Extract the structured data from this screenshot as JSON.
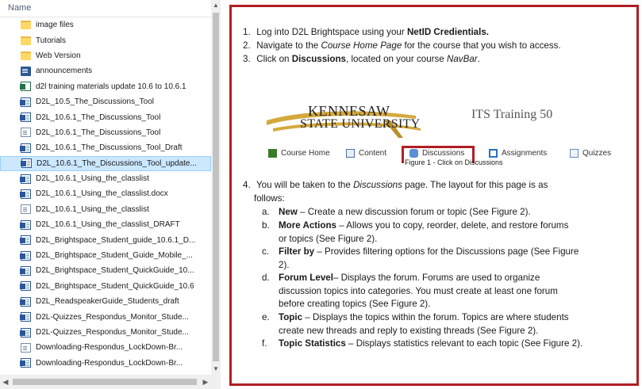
{
  "file_pane": {
    "column_header": "Name",
    "files": [
      {
        "name": "image files",
        "icon": "folder-icon",
        "type": "folder"
      },
      {
        "name": "Tutorials",
        "icon": "folder-icon",
        "type": "folder"
      },
      {
        "name": "Web Version",
        "icon": "folder-icon",
        "type": "folder"
      },
      {
        "name": "announcements",
        "icon": "docx-icon",
        "type": "docx"
      },
      {
        "name": "d2l training materials update 10.6 to 10.6.1",
        "icon": "excel-icon",
        "type": "xls"
      },
      {
        "name": "D2L_10.5_The_Discussions_Tool",
        "icon": "word-doc-icon",
        "type": "wdoc"
      },
      {
        "name": "D2L_10.6.1_The_Discussions_Tool",
        "icon": "word-doc-icon",
        "type": "wdoc"
      },
      {
        "name": "D2L_10.6.1_The_Discussions_Tool",
        "icon": "document-icon",
        "type": "plain"
      },
      {
        "name": "D2L_10.6.1_The_Discussions_Tool_Draft",
        "icon": "word-doc-icon",
        "type": "wdoc"
      },
      {
        "name": "D2L_10.6.1_The_Discussions_Tool_update...",
        "icon": "word-doc-icon",
        "type": "wdoc",
        "selected": true
      },
      {
        "name": "D2L_10.6.1_Using_the_classlist",
        "icon": "word-doc-icon",
        "type": "wdoc"
      },
      {
        "name": "D2L_10.6.1_Using_the_classlist.docx",
        "icon": "word-doc-icon",
        "type": "wdoc"
      },
      {
        "name": "D2L_10.6.1_Using_the_classlist",
        "icon": "document-icon",
        "type": "plain"
      },
      {
        "name": "D2L_10.6.1_Using_the_classlist_DRAFT",
        "icon": "word-doc-icon",
        "type": "wdoc"
      },
      {
        "name": "D2L_Brightspace_Student_guide_10.6.1_D...",
        "icon": "word-doc-icon",
        "type": "wdoc"
      },
      {
        "name": "D2L_Brightspace_Student_Guide_Mobile_...",
        "icon": "word-doc-icon",
        "type": "wdoc"
      },
      {
        "name": "D2L_Brightspace_Student_QuickGuide_10...",
        "icon": "word-doc-icon",
        "type": "wdoc"
      },
      {
        "name": "D2L_Brightspace_Student_QuickGuide_10.6",
        "icon": "word-doc-icon",
        "type": "wdoc"
      },
      {
        "name": "D2L_ReadspeakerGuide_Students_draft",
        "icon": "word-doc-icon",
        "type": "wdoc"
      },
      {
        "name": "D2L-Quizzes_Respondus_Monitor_Stude...",
        "icon": "word-doc-icon",
        "type": "wdoc"
      },
      {
        "name": "D2L-Quizzes_Respondus_Monitor_Stude...",
        "icon": "word-doc-icon",
        "type": "wdoc"
      },
      {
        "name": "Downloading-Respondus_LockDown-Br...",
        "icon": "document-icon",
        "type": "plain"
      },
      {
        "name": "Downloading-Respondus_LockDown-Br...",
        "icon": "word-doc-icon",
        "type": "wdoc"
      }
    ]
  },
  "doc": {
    "steps": [
      {
        "num": "1.",
        "pre": "Log into D2L Brightspace using your ",
        "bold": "NetID Credientials.",
        "post": ""
      },
      {
        "num": "2.",
        "pre": "Navigate to the ",
        "ital": "Course Home Page",
        "post": " for the course that you wish to access."
      },
      {
        "num": "3.",
        "pre": "Click on ",
        "bold": "Discussions",
        "mid": ", located on your course ",
        "ital": "NavBar",
        "post": "."
      }
    ],
    "embed": {
      "logo_line1": "KENNESAW",
      "logo_line2": "STATE UNIVERSITY",
      "course_title": "ITS Training 50",
      "nav": [
        "Course Home",
        "Content",
        "Discussions",
        "Assignments",
        "Quizzes"
      ],
      "figure_caption": "Figure 1 - Click on Discussions"
    },
    "step4": {
      "num": "4.",
      "line1_pre": "You will be taken to the ",
      "line1_ital": "Discussions",
      "line1_post": " page.  The layout for this page is as",
      "line2": "follows:"
    },
    "items": [
      {
        "letter": "a.",
        "term": "New",
        "lines": [
          " – Create a new discussion forum or topic (See Figure 2)."
        ]
      },
      {
        "letter": "b.",
        "term": "More Actions",
        "lines": [
          " – Allows you to copy, reorder, delete, and restore forums",
          "or topics (See Figure 2)."
        ]
      },
      {
        "letter": "c.",
        "term": "Filter by",
        "lines": [
          " – Provides filtering options for the Discussions page (See Figure",
          "2)."
        ]
      },
      {
        "letter": "d.",
        "term": "Forum Level",
        "lines": "– Displays the forum.  Forums are used to organize|discussion topics into categories.  You must create at least one forum|before creating topics (See Figure 2)."
      },
      {
        "letter": "e.",
        "term": "Topic",
        "lines": " – Displays the topics within the forum.  Topics are where students|create new threads and reply to existing threads (See Figure 2)."
      },
      {
        "letter": "f.",
        "term": "Topic Statistics",
        "lines": " – Displays statistics relevant to each topic (See Figure 2)."
      }
    ]
  },
  "colors": {
    "highlight_border": "#b01e23",
    "selected_row": "#cce8ff"
  }
}
